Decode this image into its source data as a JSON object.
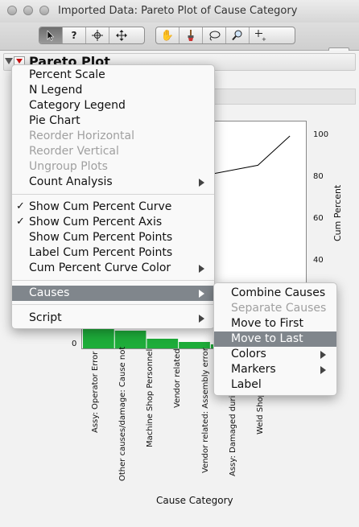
{
  "window": {
    "title": "Imported Data: Pareto Plot of Cause Category"
  },
  "outline": {
    "title": "Pareto Plot"
  },
  "chart_data": {
    "type": "bar",
    "xlabel": "Cause Category",
    "y2label": "Cum Percent",
    "categories": [
      "Assy: Operator Error",
      "Other causes/damage: Cause not",
      "Machine Shop Personnel",
      "Vendor related",
      "Vendor related: Assembly error",
      "Assy: Damaged durin",
      "Weld Shop"
    ],
    "left_ticks": [
      "0"
    ],
    "right_ticks": [
      "40",
      "60",
      "80",
      "100"
    ],
    "cum_percent_visible": [
      [
        6,
        86
      ],
      [
        7,
        100
      ]
    ],
    "bar_color": "#1ead3a"
  },
  "menu": {
    "items": [
      {
        "label": "Percent Scale"
      },
      {
        "label": "N Legend"
      },
      {
        "label": "Category Legend"
      },
      {
        "label": "Pie Chart"
      },
      {
        "label": "Reorder Horizontal"
      },
      {
        "label": "Reorder Vertical"
      },
      {
        "label": "Ungroup Plots"
      },
      {
        "label": "Count Analysis"
      },
      {
        "label": "Show Cum Percent Curve",
        "check": "✓"
      },
      {
        "label": "Show Cum Percent Axis",
        "check": "✓"
      },
      {
        "label": "Show Cum Percent Points"
      },
      {
        "label": "Label Cum Percent Points"
      },
      {
        "label": "Cum Percent Curve Color"
      },
      {
        "label": "Causes"
      },
      {
        "label": "Script"
      }
    ]
  },
  "submenu": {
    "items": [
      {
        "label": "Combine Causes"
      },
      {
        "label": "Separate Causes"
      },
      {
        "label": "Move to First"
      },
      {
        "label": "Move to Last"
      },
      {
        "label": "Colors"
      },
      {
        "label": "Markers"
      },
      {
        "label": "Label"
      }
    ]
  }
}
